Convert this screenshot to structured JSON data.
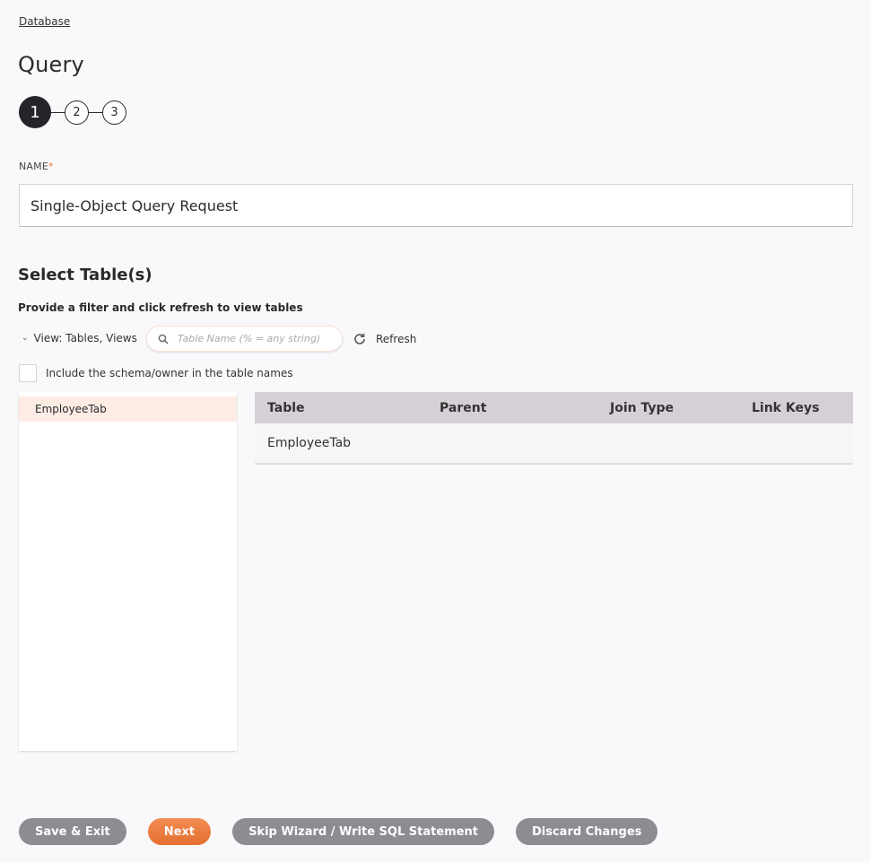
{
  "breadcrumb": "Database",
  "title": "Query",
  "stepper": {
    "current": 1,
    "steps": [
      "1",
      "2",
      "3"
    ]
  },
  "name_field": {
    "label": "NAME",
    "required_mark": "*",
    "value": "Single-Object Query Request"
  },
  "select_tables": {
    "title": "Select Table(s)",
    "hint": "Provide a filter and click refresh to view tables",
    "view_toggle": "View: Tables, Views",
    "search_placeholder": "Table Name (% = any string)",
    "refresh_label": "Refresh",
    "include_schema_label": "Include the schema/owner in the table names",
    "include_schema_checked": false,
    "available_tables": [
      "EmployeeTab"
    ],
    "grid": {
      "columns": [
        "Table",
        "Parent",
        "Join Type",
        "Link Keys"
      ],
      "rows": [
        {
          "table": "EmployeeTab",
          "parent": "",
          "join_type": "",
          "link_keys": ""
        }
      ]
    }
  },
  "footer": {
    "save_exit": "Save & Exit",
    "next": "Next",
    "skip_wizard": "Skip Wizard / Write SQL Statement",
    "discard": "Discard Changes"
  },
  "colors": {
    "accent": "#e9773a",
    "required": "#f07c3b",
    "button_gray": "#8e8b93",
    "selected_row": "#fdece4",
    "grid_header": "#d5d0d6"
  }
}
